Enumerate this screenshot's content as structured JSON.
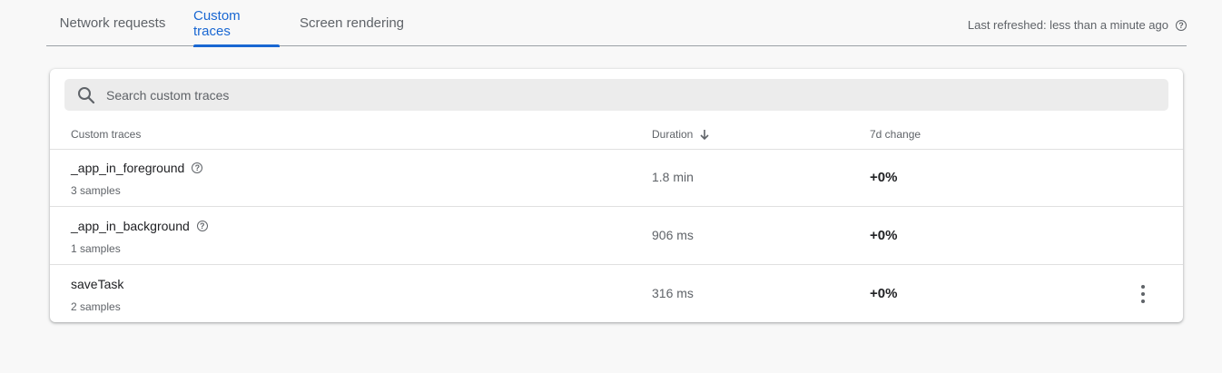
{
  "tabs": [
    {
      "label": "Network requests",
      "active": false
    },
    {
      "label": "Custom traces",
      "active": true
    },
    {
      "label": "Screen rendering",
      "active": false
    }
  ],
  "refresh": {
    "label": "Last refreshed: less than a minute ago",
    "icon": "help-icon"
  },
  "search": {
    "placeholder": "Search custom traces",
    "value": "",
    "icon": "search-icon"
  },
  "table": {
    "columns": [
      "Custom traces",
      "Duration",
      "7d change"
    ],
    "sort_icon": "arrow-down-icon",
    "rows": [
      {
        "name": "_app_in_foreground",
        "samples": "3 samples",
        "duration": "1.8 min",
        "change": "+0%",
        "has_help": true
      },
      {
        "name": "_app_in_background",
        "samples": "1 samples",
        "duration": "906 ms",
        "change": "+0%",
        "has_help": true
      },
      {
        "name": "saveTask",
        "samples": "2 samples",
        "duration": "316 ms",
        "change": "+0%",
        "has_help": false
      }
    ]
  },
  "colors": {
    "accent": "#1967d2",
    "background": "#f8f8f8",
    "card": "#ffffff"
  }
}
